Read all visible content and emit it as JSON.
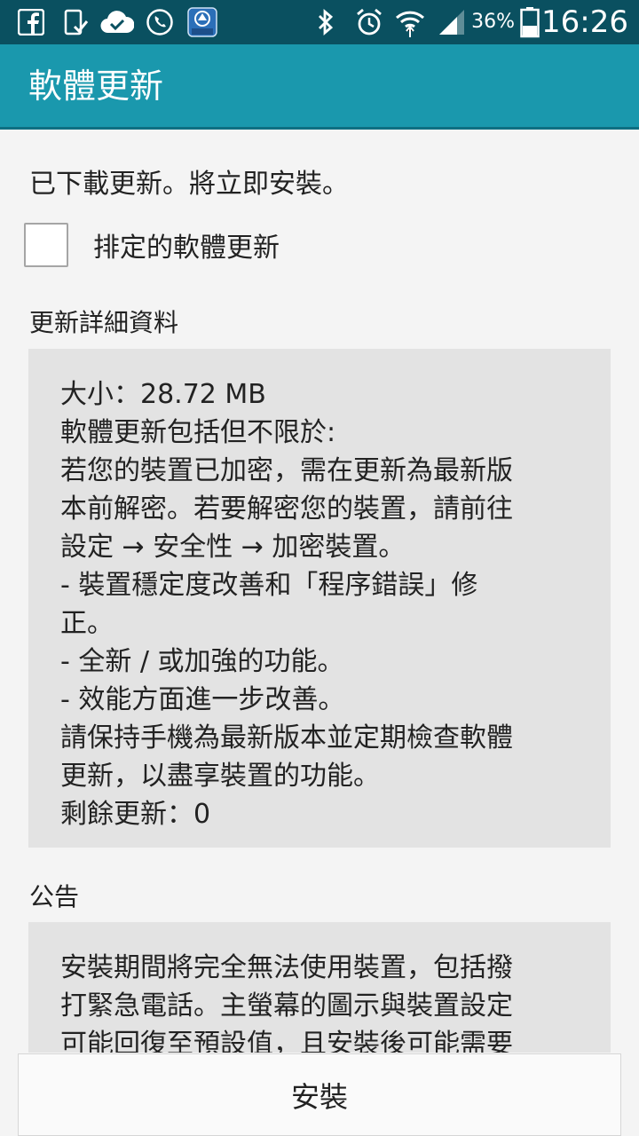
{
  "status_bar": {
    "battery_percent": "36%",
    "time": "16:26",
    "notification_icons": [
      "facebook-icon",
      "download-check-icon",
      "cloud-check-icon",
      "phone-sync-icon",
      "app-yuanta-icon"
    ],
    "system_icons": [
      "bluetooth-icon",
      "alarm-icon",
      "wifi-icon",
      "signal-icon",
      "battery-icon"
    ],
    "app_icon_text": "元大"
  },
  "app_bar": {
    "title": "軟體更新"
  },
  "main": {
    "status_message": "已下載更新。將立即安裝。",
    "scheduled_update_label": "排定的軟體更新",
    "scheduled_update_checked": false,
    "details_heading": "更新詳細資料",
    "details_lines": [
      "大小：28.72 MB",
      "軟體更新包括但不限於:",
      "若您的裝置已加密，需在更新為最新版",
      "本前解密。若要解密您的裝置，請前往",
      "設定 → 安全性 → 加密裝置。",
      " - 裝置穩定度改善和「程序錯誤」修",
      "正。",
      " - 全新 / 或加強的功能。",
      " - 效能方面進一步改善。",
      "請保持手機為最新版本並定期檢查軟體",
      "更新，以盡享裝置的功能。",
      "剩餘更新：0"
    ],
    "notice_heading": "公告",
    "notice_lines": [
      "安裝期間將完全無法使用裝置，包括撥",
      "打緊急電話。主螢幕的圖示與裝置設定",
      "可能回復至預設值，且安裝後可能需要"
    ]
  },
  "footer": {
    "install_label": "安裝"
  },
  "colors": {
    "status_bar_bg": "#0a5060",
    "app_bar_bg": "#1a98ad",
    "content_bg": "#f4f4f4",
    "box_bg": "#e3e3e3"
  }
}
